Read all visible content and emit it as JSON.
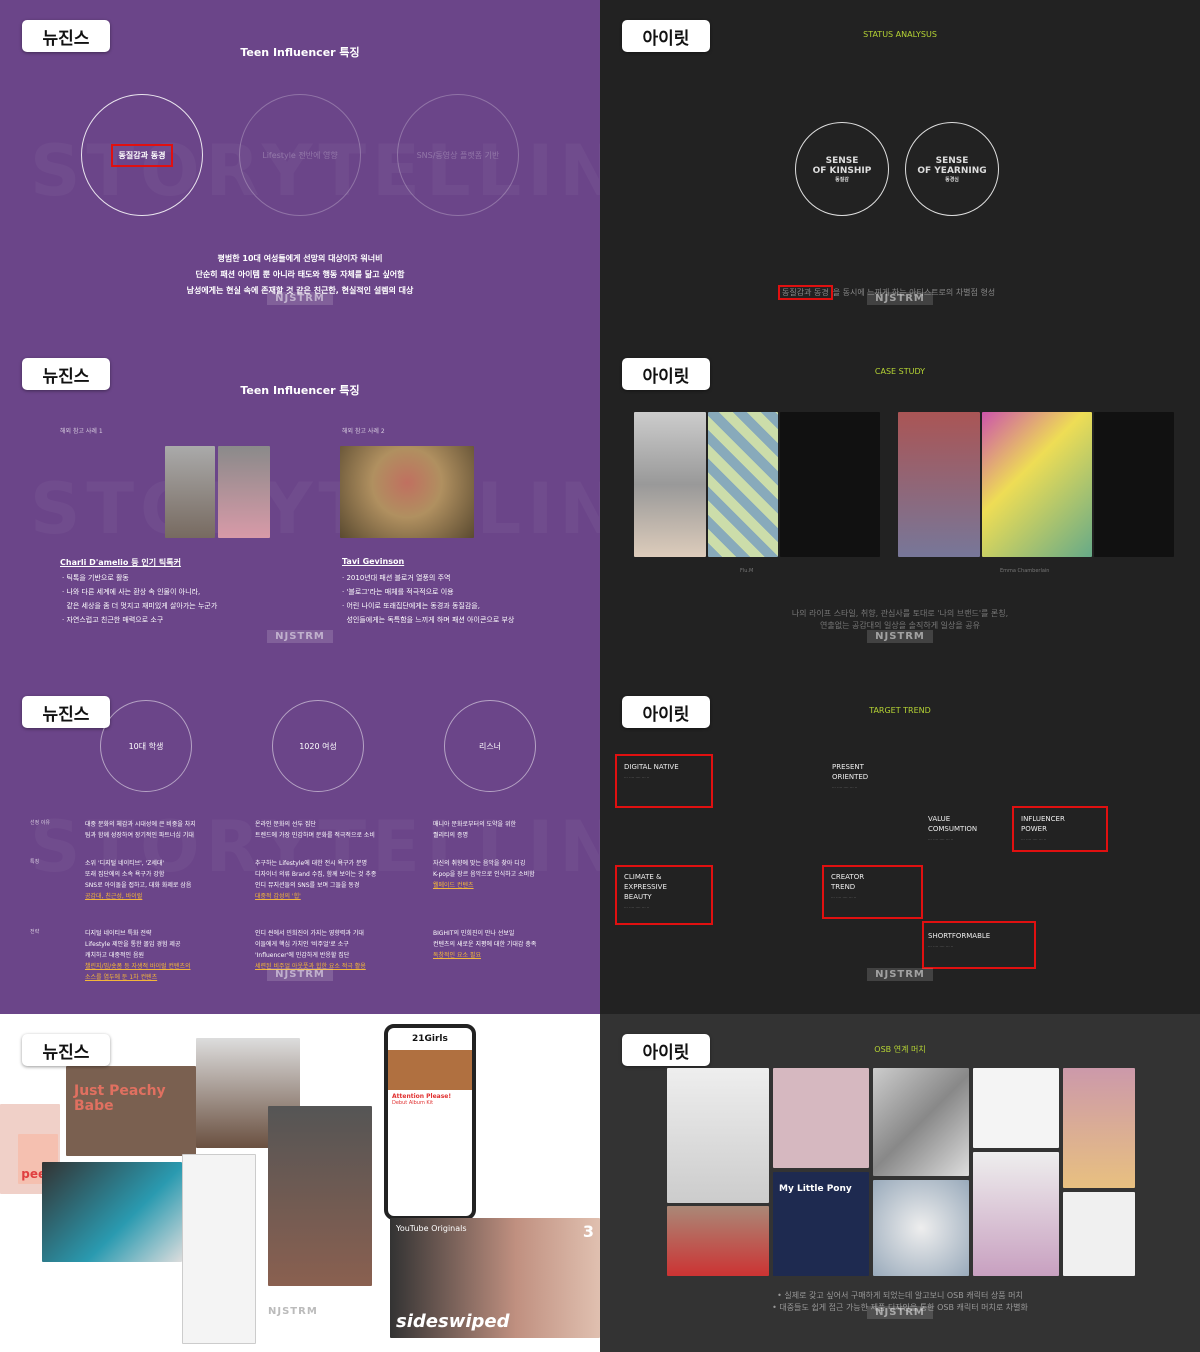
{
  "watermark": "NJSTRM",
  "ghost_text": "STORYTELLING",
  "left_tag": "뉴진스",
  "right_tag": "아이릿",
  "slide1": {
    "title": "Teen Influencer 특징",
    "circles": [
      "동질감과 동경",
      "Lifestyle 전반에 영향",
      "SNS/동영상 플랫폼 기반"
    ],
    "lines": [
      "평범한 10대 여성들에게 선망의 대상이자 워너비",
      "단순히 패션 아이템 뿐 아니라 태도와 행동 자체를 닮고 싶어함",
      "남성에게는 현실 속에 존재할 것 같은 친근한, 현실적인 설렘의 대상"
    ]
  },
  "slide2": {
    "title": "Teen Influencer 특징",
    "cases": [
      {
        "label": "해외 참고 사례 1",
        "name": "Charli D'amelio 등 인기 틱톡커",
        "bullets": [
          "틱톡을 기반으로 활동",
          "나와 다른 세계에 사는 환상 속 인물이 아니라,",
          "같은 세상을 좀 더 멋지고 재미있게 살아가는 누군가",
          "자연스럽고 친근한 매력으로 소구"
        ]
      },
      {
        "label": "해외 참고 사례 2",
        "name": "Tavi Gevinson",
        "bullets": [
          "2010년대 패션 블로거 열풍의 주역",
          "'블로그'라는 매체를 적극적으로 이용",
          "어린 나이로 또래집단에게는 동경과 동질감을,",
          "성인들에게는 독특함을 느끼게 하며 패션 아이콘으로 부상"
        ]
      }
    ]
  },
  "slide3": {
    "circles": [
      "10대 학생",
      "1020 여성",
      "리스너"
    ],
    "rows": [
      {
        "label": "선정 이유",
        "cols": [
          [
            "대중 문화의 체감과 시대성에 큰 비중을 차지",
            "팀과 함께 성장하여 장기적인 파트너십 기대"
          ],
          [
            "온라인 문화의 선두 집단",
            "트렌드에 가장 민감하며 문화를 적극적으로 소비"
          ],
          [
            "매니아 문화로부터의 도약을 위한",
            "퀄리티의 증명"
          ]
        ],
        "gold": [
          [],
          [],
          []
        ]
      },
      {
        "label": "특징",
        "cols": [
          [
            "소위 '디지털 네이티브', 'Z세대'",
            "또래 집단에의 소속 욕구가 강함",
            "SNS로 아이돌을 접하고, 대화 화제로 삼음"
          ],
          [
            "추구하는 Lifestyle에 대한 전시 욕구가 분명",
            "디자이너 의류 Brand 수집, 함께 보이는 것 추종",
            "인디 뮤지션들의 SNS를 보며 그들을 동경"
          ],
          [
            "자신의 취향에 맞는 음악을 찾아 디깅",
            "K-pop을 장르 음악으로 인식하고 소비함"
          ]
        ],
        "gold": [
          [
            "공감대, 친근성, 바이럴"
          ],
          [
            "대중적 감성의 '힙'"
          ],
          [
            "웰메이드 컨텐츠"
          ]
        ]
      },
      {
        "label": "전략",
        "cols": [
          [
            "디지털 네이티브 특화 전략",
            "Lifestyle 제안을 통한 몰입 경험 제공",
            "캐치하고 대중적인 음원"
          ],
          [
            "인디 씬에서 민희진이 가지는 영향력과 기대",
            "이들에게 핵심 가치인 '비주얼'로 소구",
            "'Influencer'에 민감하게 반응할 집단"
          ],
          [
            "BIGHIT의 민희진이 만나 선보일",
            "컨텐츠의 새로운 지평에 대한 기대감 충족"
          ]
        ],
        "gold": [
          [
            "챌린지/밈/숏폼 등 자생적 바이럴 컨텐츠의",
            "소스를 염두에 둔 1차 컨텐츠"
          ],
          [
            "세련된 비주얼 아웃풋과 힙한 요소 적극 활용"
          ],
          [
            "독창적인 요소 필요"
          ]
        ]
      }
    ]
  },
  "slide4": {
    "card_brand": "21Girls",
    "card_headline": "Attention Please!",
    "card_sub": "Debut Album Kit",
    "poster_text": "Just Peachy Babe",
    "bag_text": "peep",
    "video_brand": "YouTube Originals",
    "video_title": "sideswiped",
    "video_badge": "3"
  },
  "r1": {
    "subtitle": "STATUS ANALYSUS",
    "circles": [
      {
        "title1": "SENSE",
        "title2": "OF KINSHIP",
        "ko": "동질감"
      },
      {
        "title1": "SENSE",
        "title2": "OF YEARNING",
        "ko": "동경심"
      }
    ],
    "highlight": "동질감과 동경",
    "line_rest": "을 동시에 느끼게 하는 아티스트로의 차별점 형성"
  },
  "r2": {
    "subtitle": "CASE STUDY",
    "captions": [
      "Flu.M",
      "Emma Chamberlain"
    ],
    "lines": [
      "나의 라이프 스타일, 취향, 관심사를 토대로 '나의 브랜드'를 론칭,",
      "연출없는 공감대의 일상을 솔직하게 일상을 공유"
    ]
  },
  "r3": {
    "subtitle": "TARGET TREND",
    "items": [
      {
        "t": "DIGITAL NATIVE",
        "hl": true
      },
      {
        "t": "PRESENT ORIENTED",
        "hl": false
      },
      {
        "t": "VALUE COMSUMTION",
        "hl": false
      },
      {
        "t": "INFLUENCER POWER",
        "hl": true
      },
      {
        "t": "CLIMATE & EXPRESSIVE BEAUTY",
        "hl": true
      },
      {
        "t": "CREATOR TREND",
        "hl": true
      },
      {
        "t": "SHORTFORMABLE",
        "hl": true
      }
    ]
  },
  "r4": {
    "subtitle": "OSB 연계 머치",
    "lines": [
      "• 실제로 갖고 싶어서 구매하게 되었는데 알고보니 OSB 캐릭터 상품 머치",
      "• 대중들도 쉽게 접근 가능한 제품 디자인을 통한 OSB 캐릭터 머치로 차별화"
    ],
    "pony_text": "My Little Pony"
  },
  "colors": {
    "purple": "#6b4589",
    "dark": "#222222",
    "accent_green": "#b5d334",
    "highlight_red": "#e01010",
    "gold": "#f3b63a"
  }
}
